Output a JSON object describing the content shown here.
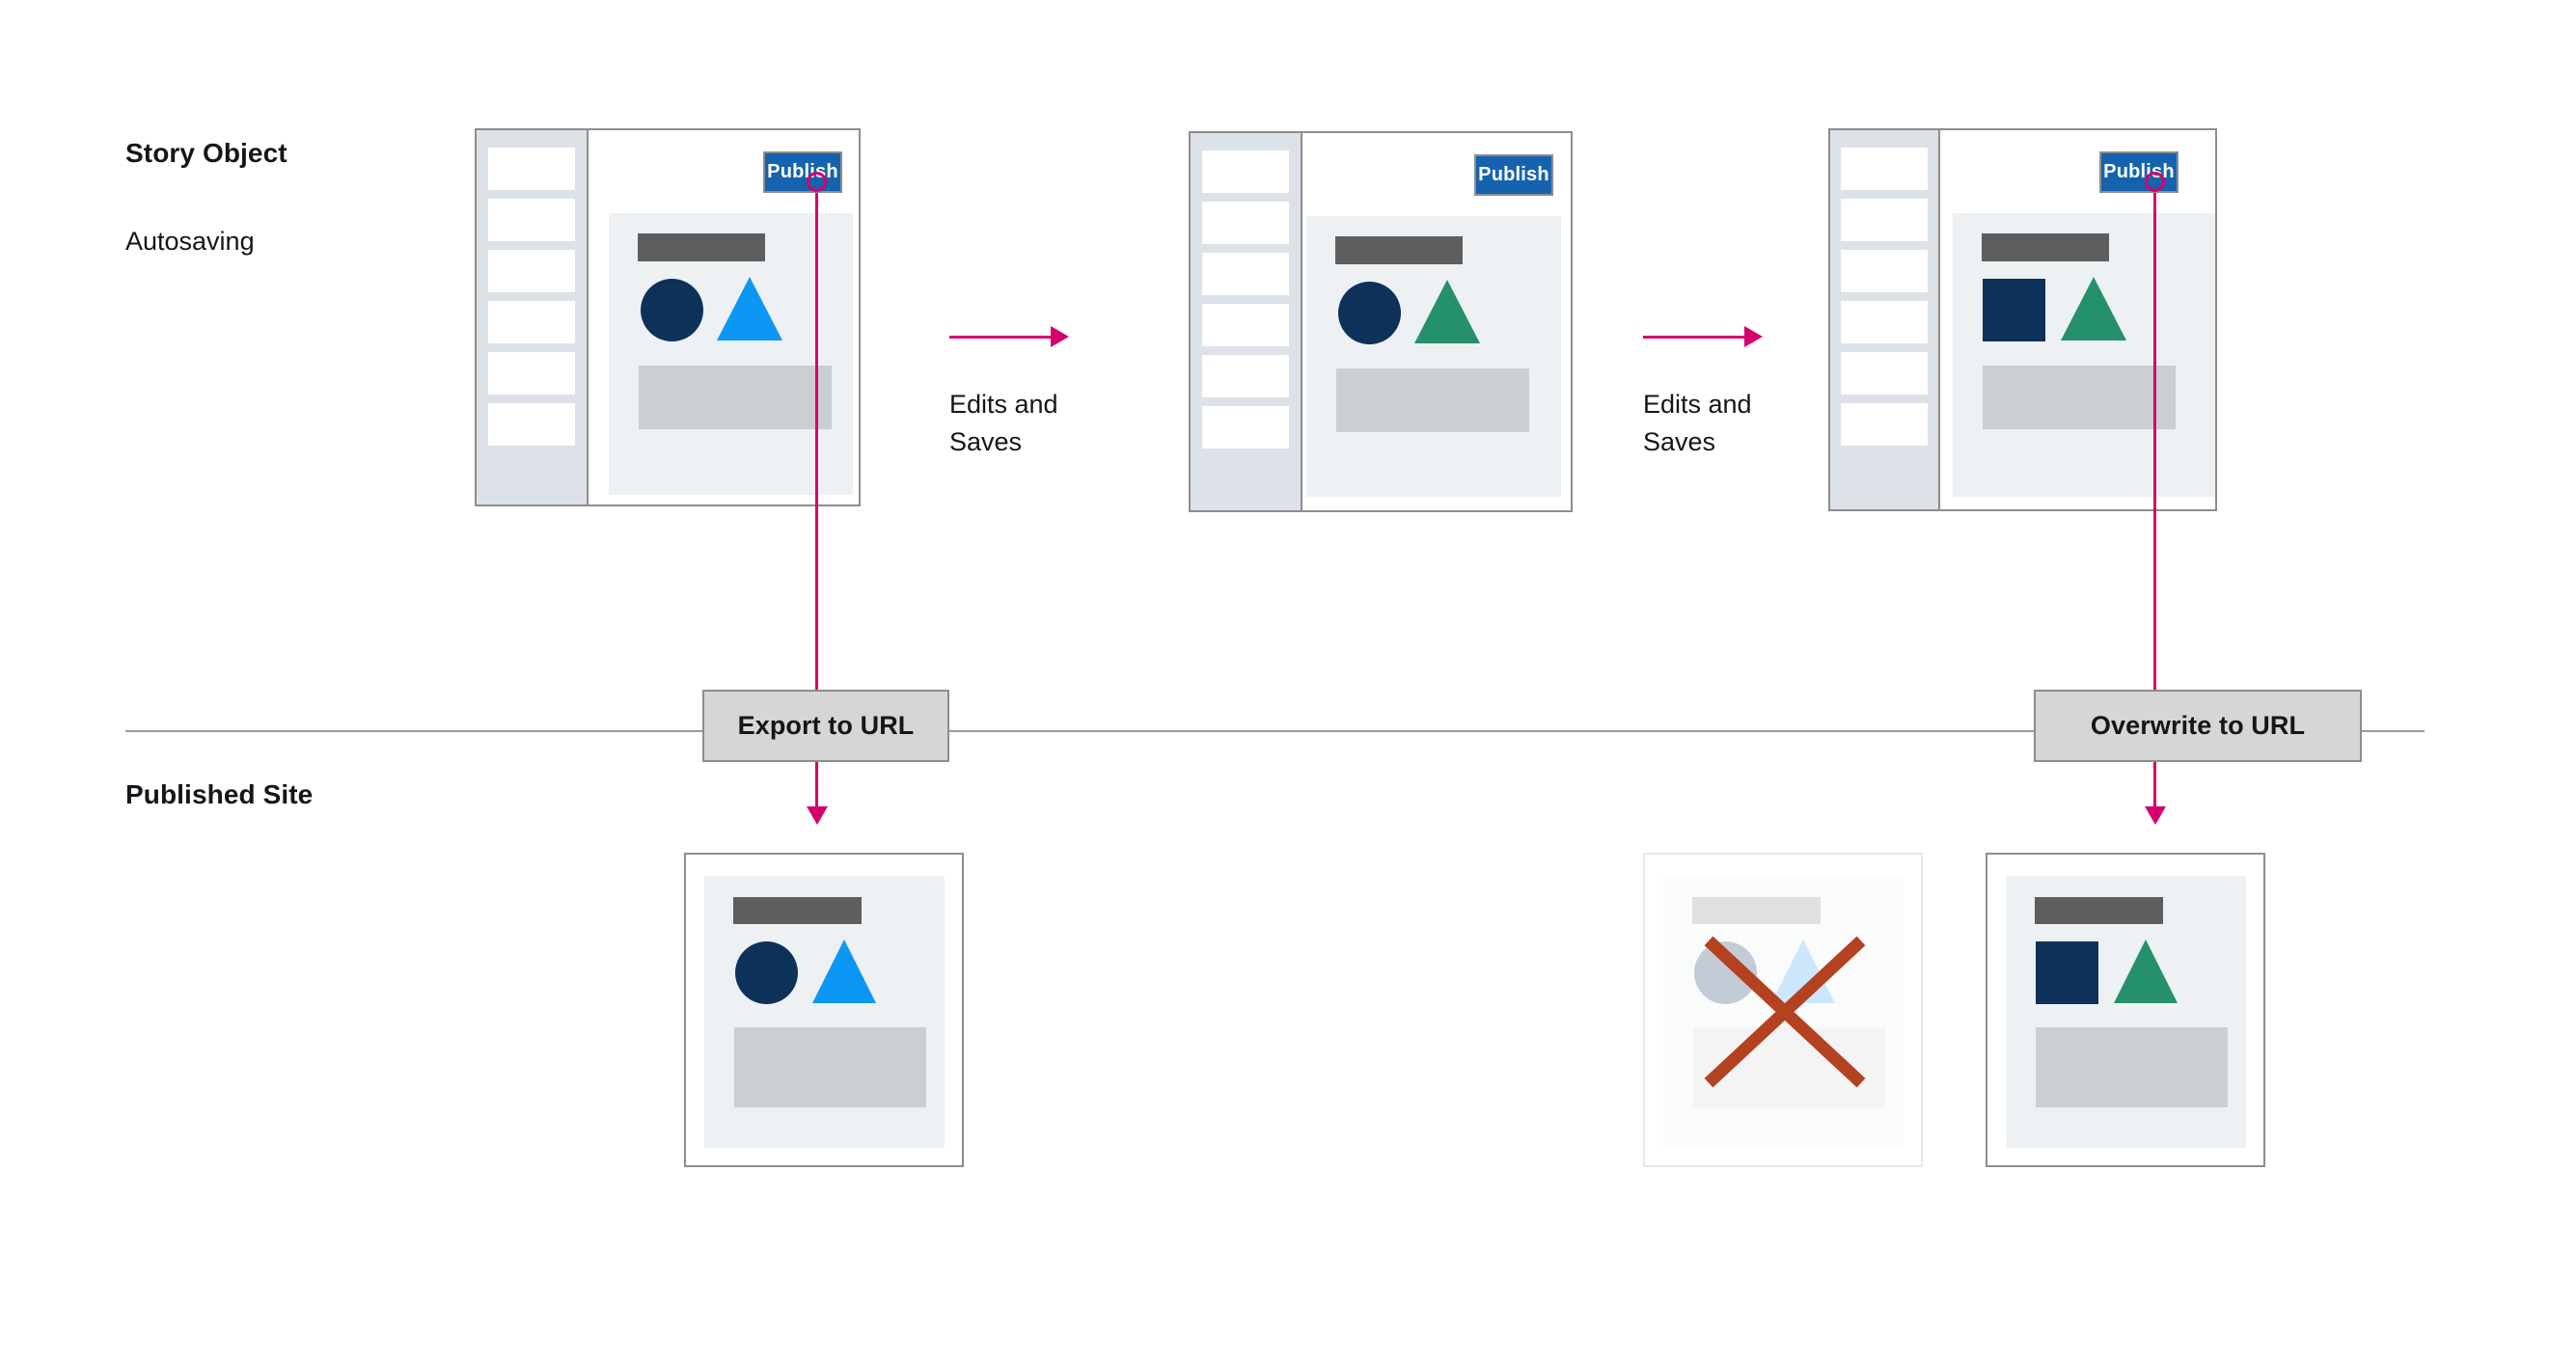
{
  "rows": {
    "story_object": {
      "title": "Story Object",
      "subtitle": "Autosaving"
    },
    "published_site": {
      "title": "Published Site"
    }
  },
  "transitions": [
    {
      "label": "Edits and\nSaves"
    },
    {
      "label": "Edits and\nSaves"
    }
  ],
  "gateways": [
    {
      "label": "Export to URL"
    },
    {
      "label": "Overwrite to URL"
    }
  ],
  "editor_windows": [
    {
      "name": "story-state-1",
      "publish_label": "Publish",
      "publish_marked": true,
      "sidebar_items": 6,
      "shapes": [
        {
          "type": "circle",
          "color": "#0d3159"
        },
        {
          "type": "triangle",
          "color": "#0d97f5"
        }
      ]
    },
    {
      "name": "story-state-2",
      "publish_label": "Publish",
      "publish_marked": false,
      "sidebar_items": 6,
      "shapes": [
        {
          "type": "circle",
          "color": "#0d3159"
        },
        {
          "type": "triangle",
          "color": "#24916c"
        }
      ]
    },
    {
      "name": "story-state-3",
      "publish_label": "Publish",
      "publish_marked": true,
      "sidebar_items": 6,
      "shapes": [
        {
          "type": "square",
          "color": "#0d3159"
        },
        {
          "type": "triangle",
          "color": "#24916c"
        }
      ]
    }
  ],
  "published_cards": [
    {
      "name": "published-v1",
      "state": "live",
      "shapes": [
        {
          "type": "circle",
          "color": "#0d3159"
        },
        {
          "type": "triangle",
          "color": "#0d97f5"
        }
      ]
    },
    {
      "name": "published-v1-replaced",
      "state": "replaced",
      "crossed_out": true,
      "cross_color": "#b4411f",
      "shapes": [
        {
          "type": "circle",
          "color": "#c3cbd6"
        },
        {
          "type": "triangle",
          "color": "#cce6fb"
        }
      ]
    },
    {
      "name": "published-v2",
      "state": "live",
      "shapes": [
        {
          "type": "square",
          "color": "#0d3159"
        },
        {
          "type": "triangle",
          "color": "#24916c"
        }
      ]
    }
  ],
  "colors": {
    "accent_pink": "#d4006e",
    "publish_blue": "#1563ae",
    "navy": "#0d3159",
    "bright_blue": "#0d97f5",
    "green": "#24916c",
    "cross_red": "#b4411f",
    "frame_gray": "#8d8d8d",
    "sidebar_gray": "#dde1e8",
    "canvas_gray": "#edf1f4",
    "headline_gray": "#5e5e5e",
    "body_gray": "#cbced3",
    "gateway_fill": "#d6d6d6"
  }
}
